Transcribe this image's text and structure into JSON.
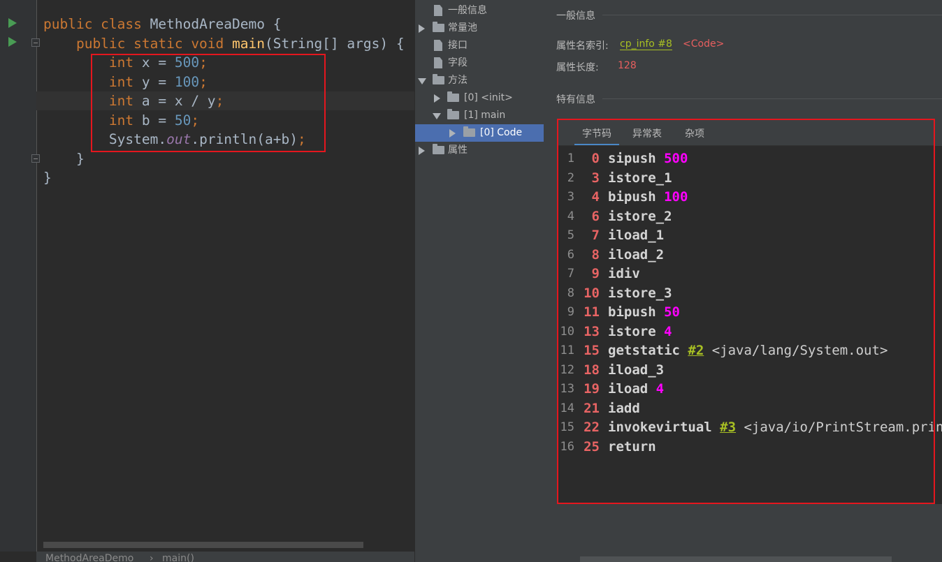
{
  "editor": {
    "lines": [
      {
        "parts": [
          {
            "t": "public class ",
            "c": "kw"
          },
          {
            "t": "MethodAreaDemo {",
            "c": "txt"
          }
        ]
      },
      {
        "parts": [
          {
            "t": "    public static void ",
            "c": "kw"
          },
          {
            "t": "main",
            "c": "fn"
          },
          {
            "t": "(String[] args) {",
            "c": "txt"
          }
        ]
      },
      {
        "parts": [
          {
            "t": "        int ",
            "c": "kw"
          },
          {
            "t": "x = ",
            "c": "txt"
          },
          {
            "t": "500",
            "c": "num"
          },
          {
            "t": ";",
            "c": "kw"
          }
        ]
      },
      {
        "parts": [
          {
            "t": "        int ",
            "c": "kw"
          },
          {
            "t": "y = ",
            "c": "txt"
          },
          {
            "t": "100",
            "c": "num"
          },
          {
            "t": ";",
            "c": "kw"
          }
        ]
      },
      {
        "parts": [
          {
            "t": "        int ",
            "c": "kw"
          },
          {
            "t": "a = x / y",
            "c": "txt"
          },
          {
            "t": ";",
            "c": "kw"
          }
        ]
      },
      {
        "parts": [
          {
            "t": "        int ",
            "c": "kw"
          },
          {
            "t": "b = ",
            "c": "txt"
          },
          {
            "t": "50",
            "c": "num"
          },
          {
            "t": ";",
            "c": "kw"
          }
        ]
      },
      {
        "parts": [
          {
            "t": "        System.",
            "c": "txt"
          },
          {
            "t": "out",
            "c": "fld"
          },
          {
            "t": ".println(a+b)",
            "c": "txt"
          },
          {
            "t": ";",
            "c": "kw"
          }
        ]
      },
      {
        "parts": [
          {
            "t": "    }",
            "c": "txt"
          }
        ]
      },
      {
        "parts": [
          {
            "t": "}",
            "c": "txt"
          }
        ]
      }
    ],
    "breadcrumb": {
      "class_name": "MethodAreaDemo",
      "separator": "›",
      "method": "main()"
    }
  },
  "tree": {
    "general_info": "一般信息",
    "constant_pool": "常量池",
    "interfaces": "接口",
    "fields": "字段",
    "methods": "方法",
    "method_init": "[0] <init>",
    "method_main": "[1] main",
    "code_attr": "[0] Code",
    "attributes": "属性"
  },
  "details": {
    "general_title": "一般信息",
    "name_index_label": "属性名索引:",
    "name_index_link": "cp_info #8",
    "name_index_value": "<Code>",
    "length_label": "属性长度:",
    "length_value": "128",
    "specific_title": "特有信息",
    "tabs": {
      "bytecode": "字节码",
      "exceptions": "异常表",
      "misc": "杂项"
    },
    "bytecode": [
      {
        "ln": "1",
        "off": "0",
        "instr": [
          {
            "t": "sipush ",
            "c": "i"
          },
          {
            "t": "500",
            "c": "op"
          }
        ]
      },
      {
        "ln": "2",
        "off": "3",
        "instr": [
          {
            "t": "istore_1",
            "c": "i"
          }
        ]
      },
      {
        "ln": "3",
        "off": "4",
        "instr": [
          {
            "t": "bipush ",
            "c": "i"
          },
          {
            "t": "100",
            "c": "op"
          }
        ]
      },
      {
        "ln": "4",
        "off": "6",
        "instr": [
          {
            "t": "istore_2",
            "c": "i"
          }
        ]
      },
      {
        "ln": "5",
        "off": "7",
        "instr": [
          {
            "t": "iload_1",
            "c": "i"
          }
        ]
      },
      {
        "ln": "6",
        "off": "8",
        "instr": [
          {
            "t": "iload_2",
            "c": "i"
          }
        ]
      },
      {
        "ln": "7",
        "off": "9",
        "instr": [
          {
            "t": "idiv",
            "c": "i"
          }
        ]
      },
      {
        "ln": "8",
        "off": "10",
        "instr": [
          {
            "t": "istore_3",
            "c": "i"
          }
        ]
      },
      {
        "ln": "9",
        "off": "11",
        "instr": [
          {
            "t": "bipush ",
            "c": "i"
          },
          {
            "t": "50",
            "c": "op"
          }
        ]
      },
      {
        "ln": "10",
        "off": "13",
        "instr": [
          {
            "t": "istore ",
            "c": "i"
          },
          {
            "t": "4",
            "c": "op"
          }
        ]
      },
      {
        "ln": "11",
        "off": "15",
        "instr": [
          {
            "t": "getstatic ",
            "c": "i"
          },
          {
            "t": "#2",
            "c": "ref"
          },
          {
            "t": " <java/lang/System.out>",
            "c": "cmt"
          }
        ]
      },
      {
        "ln": "12",
        "off": "18",
        "instr": [
          {
            "t": "iload_3",
            "c": "i"
          }
        ]
      },
      {
        "ln": "13",
        "off": "19",
        "instr": [
          {
            "t": "iload ",
            "c": "i"
          },
          {
            "t": "4",
            "c": "op"
          }
        ]
      },
      {
        "ln": "14",
        "off": "21",
        "instr": [
          {
            "t": "iadd",
            "c": "i"
          }
        ]
      },
      {
        "ln": "15",
        "off": "22",
        "instr": [
          {
            "t": "invokevirtual ",
            "c": "i"
          },
          {
            "t": "#3",
            "c": "ref"
          },
          {
            "t": " <java/io/PrintStream.println>",
            "c": "cmt"
          }
        ]
      },
      {
        "ln": "16",
        "off": "25",
        "instr": [
          {
            "t": "return",
            "c": "i"
          }
        ]
      }
    ]
  },
  "colors": {
    "keyword": "#cc7832",
    "number": "#6897bb",
    "function": "#ffc66d",
    "operand": "#ff00ff",
    "offset": "#e86464",
    "link": "#a8c023",
    "highlight": "#e5161e",
    "selection": "#4b6eaf"
  }
}
